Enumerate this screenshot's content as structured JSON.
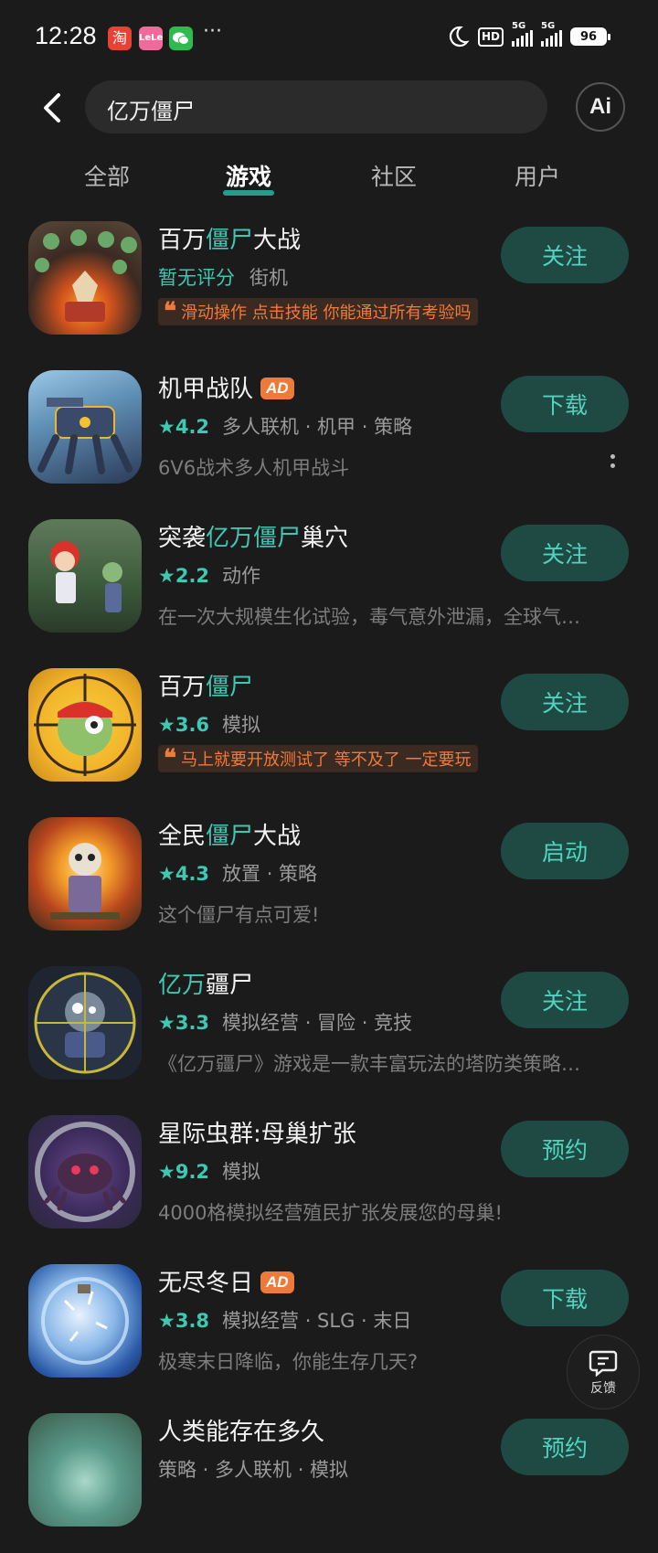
{
  "status_bar": {
    "time": "12:28",
    "apps": [
      "taobao",
      "lelei",
      "wechat"
    ],
    "more": "···",
    "network_1": "5G",
    "network_2": "5G",
    "battery": "96"
  },
  "header": {
    "search_value": "亿万僵尸",
    "ai_label": "Ai"
  },
  "tabs": [
    {
      "label": "全部"
    },
    {
      "label": "游戏",
      "active": true
    },
    {
      "label": "社区"
    },
    {
      "label": "用户"
    }
  ],
  "results": [
    {
      "title_parts": [
        "百万",
        "僵尸",
        "大战"
      ],
      "rating_text": "暂无评分",
      "tags": "街机",
      "quote": "滑动操作 点击技能 你能通过所有考验吗",
      "button": "关注",
      "ad": false
    },
    {
      "title_parts": [
        "机甲战队",
        "",
        ""
      ],
      "ad_label": "AD",
      "rating": "4.2",
      "tags": "多人联机 · 机甲 · 策略",
      "desc": "6V6战术多人机甲战斗",
      "button": "下载",
      "ad": true
    },
    {
      "title_parts": [
        "突袭",
        "亿万僵尸",
        "巢穴"
      ],
      "rating": "2.2",
      "tags": "动作",
      "desc": "在一次大规模生化试验，毒气意外泄漏，全球气…",
      "button": "关注",
      "ad": false
    },
    {
      "title_parts": [
        "百万",
        "僵尸",
        ""
      ],
      "rating": "3.6",
      "tags": "模拟",
      "quote": "马上就要开放测试了 等不及了 一定要玩",
      "button": "关注",
      "ad": false
    },
    {
      "title_parts": [
        "全民",
        "僵尸",
        "大战"
      ],
      "rating": "4.3",
      "tags": "放置 · 策略",
      "desc": "这个僵尸有点可爱!",
      "button": "启动",
      "ad": false
    },
    {
      "title_parts": [
        "",
        "亿万",
        "疆尸"
      ],
      "rating": "3.3",
      "tags": "模拟经营 · 冒险 · 竞技",
      "desc": "《亿万疆尸》游戏是一款丰富玩法的塔防类策略…",
      "button": "关注",
      "ad": false
    },
    {
      "title_parts": [
        "星际虫群:母巢扩张",
        "",
        ""
      ],
      "rating": "9.2",
      "tags": "模拟",
      "desc": "4000格模拟经营殖民扩张发展您的母巢!",
      "button": "预约",
      "ad": false
    },
    {
      "title_parts": [
        "无尽冬日",
        "",
        ""
      ],
      "ad_label": "AD",
      "rating": "3.8",
      "tags": "模拟经营 · SLG · 末日",
      "desc": "极寒末日降临，你能生存几天?",
      "button": "下载",
      "ad": true
    },
    {
      "title_parts": [
        "人类能存在多久",
        "",
        ""
      ],
      "rating": "",
      "tags": "策略 · 多人联机 · 模拟",
      "desc": "",
      "button": "预约",
      "ad": false
    }
  ],
  "feedback": {
    "label": "反馈"
  },
  "colors": {
    "accent": "#3fc7b2",
    "button_bg": "#1f4a43",
    "quote": "#f07a3a",
    "ad": "#ee7a3a"
  }
}
